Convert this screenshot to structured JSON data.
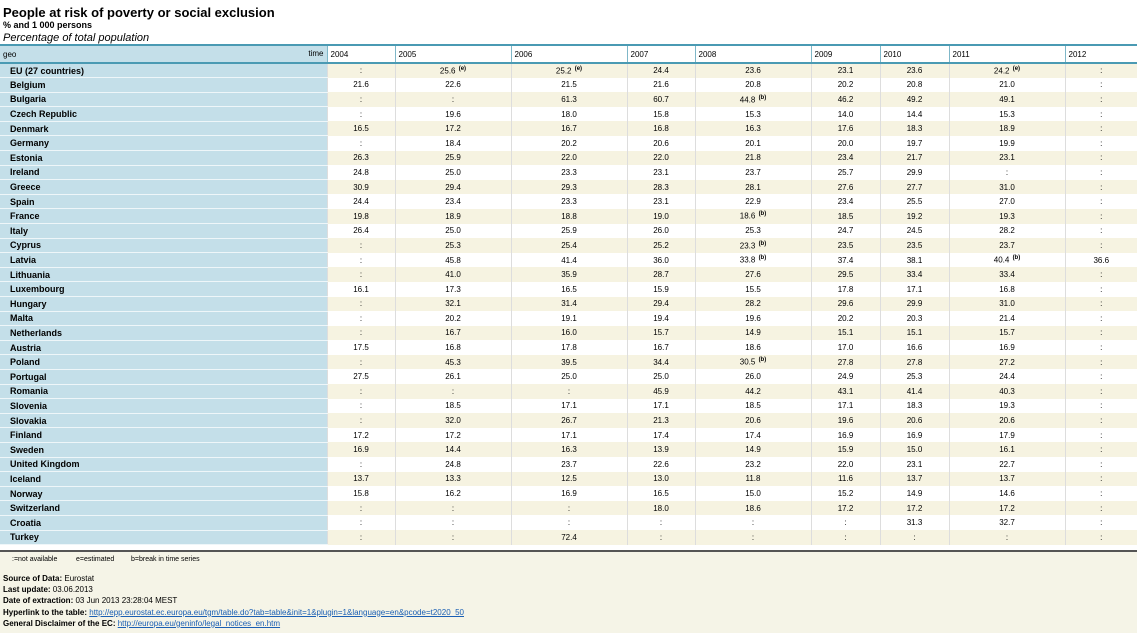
{
  "header": {
    "title": "People at risk of poverty or social exclusion",
    "subtitle": "% and 1 000 persons",
    "unit": "Percentage of total population"
  },
  "table": {
    "geo_label": "geo",
    "time_label": "time",
    "years": [
      "2004",
      "2005",
      "2006",
      "2007",
      "2008",
      "2009",
      "2010",
      "2011",
      "2012"
    ],
    "rows": [
      {
        "country": "EU (27 countries)",
        "values": [
          ":",
          "25.6 (e)",
          "25.2 (e)",
          "24.4",
          "23.6",
          "23.1",
          "23.6",
          "24.2 (e)",
          ":"
        ]
      },
      {
        "country": "Belgium",
        "values": [
          "21.6",
          "22.6",
          "21.5",
          "21.6",
          "20.8",
          "20.2",
          "20.8",
          "21.0",
          ":"
        ]
      },
      {
        "country": "Bulgaria",
        "values": [
          ":",
          ":",
          "61.3",
          "60.7",
          "44.8 (b)",
          "46.2",
          "49.2",
          "49.1",
          ":"
        ]
      },
      {
        "country": "Czech Republic",
        "values": [
          ":",
          "19.6",
          "18.0",
          "15.8",
          "15.3",
          "14.0",
          "14.4",
          "15.3",
          ":"
        ]
      },
      {
        "country": "Denmark",
        "values": [
          "16.5",
          "17.2",
          "16.7",
          "16.8",
          "16.3",
          "17.6",
          "18.3",
          "18.9",
          ":"
        ]
      },
      {
        "country": "Germany",
        "values": [
          ":",
          "18.4",
          "20.2",
          "20.6",
          "20.1",
          "20.0",
          "19.7",
          "19.9",
          ":"
        ]
      },
      {
        "country": "Estonia",
        "values": [
          "26.3",
          "25.9",
          "22.0",
          "22.0",
          "21.8",
          "23.4",
          "21.7",
          "23.1",
          ":"
        ]
      },
      {
        "country": "Ireland",
        "values": [
          "24.8",
          "25.0",
          "23.3",
          "23.1",
          "23.7",
          "25.7",
          "29.9",
          ":",
          ":"
        ]
      },
      {
        "country": "Greece",
        "values": [
          "30.9",
          "29.4",
          "29.3",
          "28.3",
          "28.1",
          "27.6",
          "27.7",
          "31.0",
          ":"
        ]
      },
      {
        "country": "Spain",
        "values": [
          "24.4",
          "23.4",
          "23.3",
          "23.1",
          "22.9",
          "23.4",
          "25.5",
          "27.0",
          ":"
        ]
      },
      {
        "country": "France",
        "values": [
          "19.8",
          "18.9",
          "18.8",
          "19.0",
          "18.6 (b)",
          "18.5",
          "19.2",
          "19.3",
          ":"
        ]
      },
      {
        "country": "Italy",
        "values": [
          "26.4",
          "25.0",
          "25.9",
          "26.0",
          "25.3",
          "24.7",
          "24.5",
          "28.2",
          ":"
        ]
      },
      {
        "country": "Cyprus",
        "values": [
          ":",
          "25.3",
          "25.4",
          "25.2",
          "23.3 (b)",
          "23.5",
          "23.5",
          "23.7",
          ":"
        ]
      },
      {
        "country": "Latvia",
        "values": [
          ":",
          "45.8",
          "41.4",
          "36.0",
          "33.8 (b)",
          "37.4",
          "38.1",
          "40.4 (b)",
          "36.6"
        ]
      },
      {
        "country": "Lithuania",
        "values": [
          ":",
          "41.0",
          "35.9",
          "28.7",
          "27.6",
          "29.5",
          "33.4",
          "33.4",
          ":"
        ]
      },
      {
        "country": "Luxembourg",
        "values": [
          "16.1",
          "17.3",
          "16.5",
          "15.9",
          "15.5",
          "17.8",
          "17.1",
          "16.8",
          ":"
        ]
      },
      {
        "country": "Hungary",
        "values": [
          ":",
          "32.1",
          "31.4",
          "29.4",
          "28.2",
          "29.6",
          "29.9",
          "31.0",
          ":"
        ]
      },
      {
        "country": "Malta",
        "values": [
          ":",
          "20.2",
          "19.1",
          "19.4",
          "19.6",
          "20.2",
          "20.3",
          "21.4",
          ":"
        ]
      },
      {
        "country": "Netherlands",
        "values": [
          ":",
          "16.7",
          "16.0",
          "15.7",
          "14.9",
          "15.1",
          "15.1",
          "15.7",
          ":"
        ]
      },
      {
        "country": "Austria",
        "values": [
          "17.5",
          "16.8",
          "17.8",
          "16.7",
          "18.6",
          "17.0",
          "16.6",
          "16.9",
          ":"
        ]
      },
      {
        "country": "Poland",
        "values": [
          ":",
          "45.3",
          "39.5",
          "34.4",
          "30.5 (b)",
          "27.8",
          "27.8",
          "27.2",
          ":"
        ]
      },
      {
        "country": "Portugal",
        "values": [
          "27.5",
          "26.1",
          "25.0",
          "25.0",
          "26.0",
          "24.9",
          "25.3",
          "24.4",
          ":"
        ]
      },
      {
        "country": "Romania",
        "values": [
          ":",
          ":",
          ":",
          "45.9",
          "44.2",
          "43.1",
          "41.4",
          "40.3",
          ":"
        ]
      },
      {
        "country": "Slovenia",
        "values": [
          ":",
          "18.5",
          "17.1",
          "17.1",
          "18.5",
          "17.1",
          "18.3",
          "19.3",
          ":"
        ]
      },
      {
        "country": "Slovakia",
        "values": [
          ":",
          "32.0",
          "26.7",
          "21.3",
          "20.6",
          "19.6",
          "20.6",
          "20.6",
          ":"
        ]
      },
      {
        "country": "Finland",
        "values": [
          "17.2",
          "17.2",
          "17.1",
          "17.4",
          "17.4",
          "16.9",
          "16.9",
          "17.9",
          ":"
        ]
      },
      {
        "country": "Sweden",
        "values": [
          "16.9",
          "14.4",
          "16.3",
          "13.9",
          "14.9",
          "15.9",
          "15.0",
          "16.1",
          ":"
        ]
      },
      {
        "country": "United Kingdom",
        "values": [
          ":",
          "24.8",
          "23.7",
          "22.6",
          "23.2",
          "22.0",
          "23.1",
          "22.7",
          ":"
        ]
      },
      {
        "country": "Iceland",
        "values": [
          "13.7",
          "13.3",
          "12.5",
          "13.0",
          "11.8",
          "11.6",
          "13.7",
          "13.7",
          ":"
        ]
      },
      {
        "country": "Norway",
        "values": [
          "15.8",
          "16.2",
          "16.9",
          "16.5",
          "15.0",
          "15.2",
          "14.9",
          "14.6",
          ":"
        ]
      },
      {
        "country": "Switzerland",
        "values": [
          ":",
          ":",
          ":",
          "18.0",
          "18.6",
          "17.2",
          "17.2",
          "17.2",
          ":"
        ]
      },
      {
        "country": "Croatia",
        "values": [
          ":",
          ":",
          ":",
          ":",
          ":",
          ":",
          "31.3",
          "32.7",
          ":"
        ]
      },
      {
        "country": "Turkey",
        "values": [
          ":",
          ":",
          "72.4",
          ":",
          ":",
          ":",
          ":",
          ":",
          ":"
        ]
      }
    ]
  },
  "legend": {
    "not_available": ":=not available",
    "estimated": "e=estimated",
    "break": "b=break in time series"
  },
  "footer": {
    "source_label": "Source of Data:",
    "source_value": "Eurostat",
    "update_label": "Last update:",
    "update_value": "03.06.2013",
    "extraction_label": "Date of extraction:",
    "extraction_value": "03 Jun 2013 23:28:04 MEST",
    "hyperlink_label": "Hyperlink to the table:",
    "hyperlink_value": "http://epp.eurostat.ec.europa.eu/tgm/table.do?tab=table&init=1&plugin=1&language=en&pcode=t2020_50",
    "disclaimer_label": "General Disclaimer of the EC:",
    "disclaimer_value": "http://europa.eu/geninfo/legal_notices_en.htm"
  }
}
